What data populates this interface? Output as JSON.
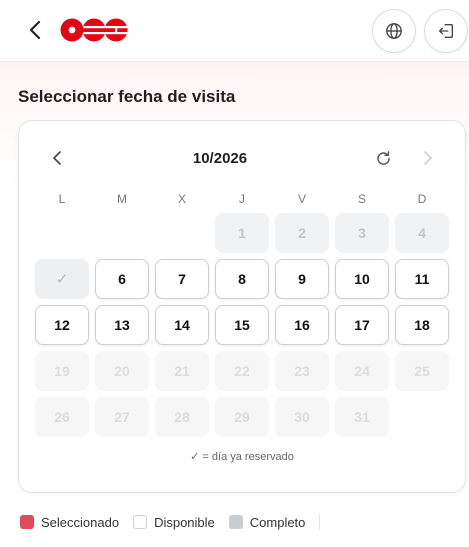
{
  "header": {
    "back_icon": "chevron-left-icon",
    "logo_icon": "brand-logo",
    "brand_color": "#e30613",
    "globe_icon": "globe-icon",
    "exit_icon": "sign-in-icon"
  },
  "page": {
    "title": "Seleccionar fecha de visita"
  },
  "calendar": {
    "month_label": "10/2026",
    "prev_icon": "chevron-left-icon",
    "refresh_icon": "refresh-icon",
    "next_icon": "chevron-right-icon",
    "weekdays": [
      "L",
      "M",
      "X",
      "J",
      "V",
      "S",
      "D"
    ],
    "days": [
      {
        "label": "1",
        "status": "full"
      },
      {
        "label": "2",
        "status": "full"
      },
      {
        "label": "3",
        "status": "full"
      },
      {
        "label": "4",
        "status": "full"
      },
      {
        "label": "✓",
        "status": "reserved"
      },
      {
        "label": "6",
        "status": "available"
      },
      {
        "label": "7",
        "status": "available"
      },
      {
        "label": "8",
        "status": "available"
      },
      {
        "label": "9",
        "status": "available"
      },
      {
        "label": "10",
        "status": "available"
      },
      {
        "label": "11",
        "status": "available"
      },
      {
        "label": "12",
        "status": "available"
      },
      {
        "label": "13",
        "status": "available"
      },
      {
        "label": "14",
        "status": "available"
      },
      {
        "label": "15",
        "status": "available"
      },
      {
        "label": "16",
        "status": "available"
      },
      {
        "label": "17",
        "status": "available"
      },
      {
        "label": "18",
        "status": "available"
      },
      {
        "label": "19",
        "status": "disabled"
      },
      {
        "label": "20",
        "status": "disabled"
      },
      {
        "label": "21",
        "status": "disabled"
      },
      {
        "label": "22",
        "status": "disabled"
      },
      {
        "label": "23",
        "status": "disabled"
      },
      {
        "label": "24",
        "status": "disabled"
      },
      {
        "label": "25",
        "status": "disabled"
      },
      {
        "label": "26",
        "status": "disabled"
      },
      {
        "label": "27",
        "status": "disabled"
      },
      {
        "label": "28",
        "status": "disabled"
      },
      {
        "label": "29",
        "status": "disabled"
      },
      {
        "label": "30",
        "status": "disabled"
      },
      {
        "label": "31",
        "status": "disabled"
      }
    ],
    "note": "✓ = día ya reservado"
  },
  "legend": {
    "selected_label": "Seleccionado",
    "available_label": "Disponible",
    "full_label": "Completo",
    "selected_color": "#e0495f",
    "full_color": "#c9ccd1"
  }
}
